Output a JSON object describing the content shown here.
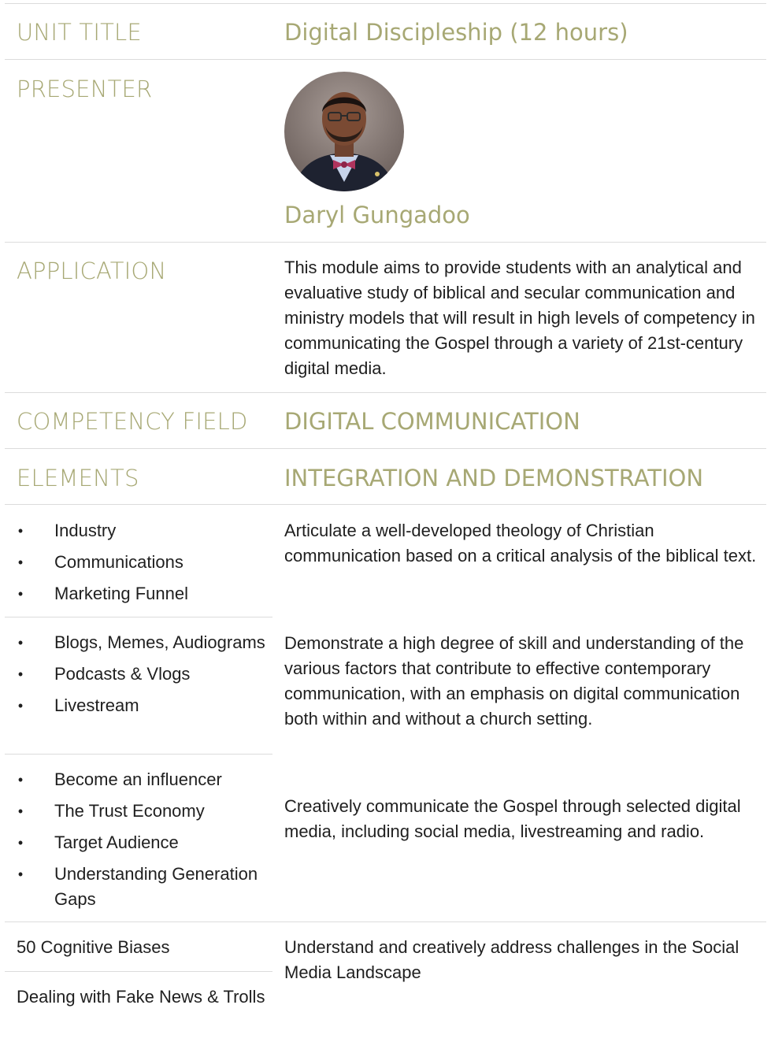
{
  "rows": {
    "unit_title": {
      "label": "UNIT TITLE",
      "value": "Digital Discipleship (12 hours)"
    },
    "presenter": {
      "label": "PRESENTER",
      "name": "Daryl Gungadoo"
    },
    "application": {
      "label": "APPLICATION",
      "text": "This module aims to provide students with an analytical and evaluative study of biblical and secular communication and ministry models that will result in high levels of competency in communicating the Gospel through a variety of 21st-century digital media."
    },
    "competency": {
      "label": "COMPETENCY FIELD",
      "value": "DIGITAL COMMUNICATION"
    },
    "elements": {
      "label": "ELEMENTS",
      "value": "INTEGRATION AND DEMONSTRATION"
    }
  },
  "groups": [
    {
      "items": [
        "Industry",
        "Communications",
        "Marketing Funnel"
      ],
      "text": "Articulate a well-developed theology of Christian communication based on a critical analysis of the biblical text."
    },
    {
      "items": [
        "Blogs, Memes, Audiograms",
        "Podcasts & Vlogs",
        "Livestream"
      ],
      "text": "Demonstrate a high degree of skill and understanding of the various factors that contribute to effective contemporary communication, with an emphasis on digital communication both within and without a church setting."
    },
    {
      "items": [
        "Become an influencer",
        "The Trust Economy",
        "Target Audience",
        "Understanding Generation Gaps"
      ],
      "text": "Creatively communicate the Gospel through selected digital media, including social media, livestreaming and radio."
    }
  ],
  "last": {
    "items": [
      "50 Cognitive Biases",
      "Dealing with Fake News & Trolls"
    ],
    "text": "Understand and creatively address challenges in the Social Media Landscape"
  },
  "bullet_glyph": "•",
  "colors": {
    "heading": "#a7a874",
    "body": "#1f1f1f",
    "rule": "#dcdcdc"
  }
}
